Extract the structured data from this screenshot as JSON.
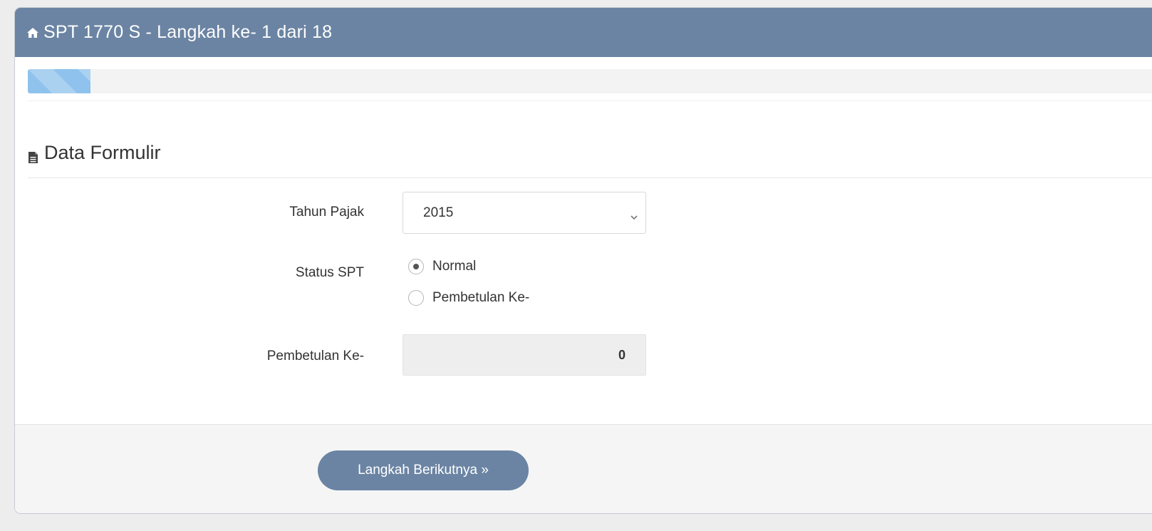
{
  "header": {
    "title": "SPT 1770 S - Langkah ke- 1 dari 18",
    "icon": "home-icon",
    "color": "#6b84a3"
  },
  "progress": {
    "step": 1,
    "total": 18,
    "fraction": 0.056,
    "color": "#8fc2ec"
  },
  "section": {
    "title": "Data Formulir",
    "icon": "document-icon"
  },
  "form": {
    "tahun_label": "Tahun Pajak",
    "tahun_value": "2015",
    "status_label": "Status SPT",
    "status_options": [
      {
        "label": "Normal",
        "checked": true
      },
      {
        "label": "Pembetulan Ke-",
        "checked": false
      }
    ],
    "pembetulan_label": "Pembetulan Ke-",
    "pembetulan_value": "0"
  },
  "footer": {
    "next_label": "Langkah Berikutnya »"
  }
}
